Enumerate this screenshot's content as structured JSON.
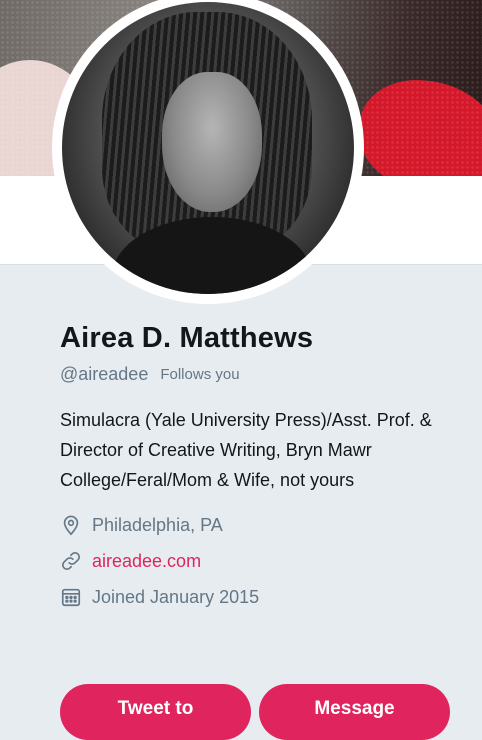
{
  "profile": {
    "name": "Airea D. Matthews",
    "handle": "@aireadee",
    "follows_you": "Follows you",
    "bio": "Simulacra (Yale University Press)/Asst. Prof. & Director of Creative Writing, Bryn Mawr College/Feral/Mom & Wife, not yours",
    "location": "Philadelphia, PA",
    "website": "aireadee.com",
    "joined": "Joined January 2015"
  },
  "actions": {
    "tweet_to": "Tweet to",
    "message": "Message"
  },
  "colors": {
    "accent": "#e0245e",
    "secondary_text": "#657786",
    "primary_text": "#14171a",
    "background": "#e6ecf0"
  },
  "icons": {
    "location": "location-pin-icon",
    "website": "link-icon",
    "joined": "calendar-icon"
  }
}
